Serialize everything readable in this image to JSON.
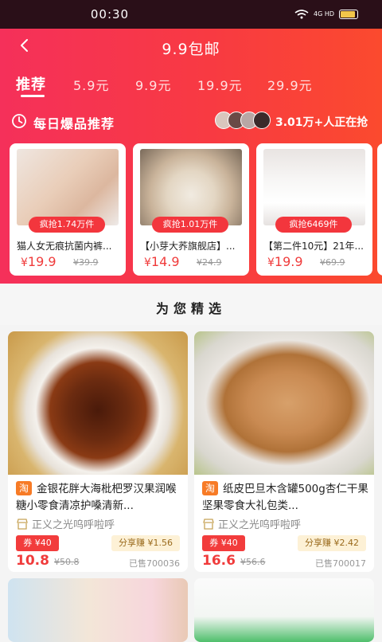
{
  "status": {
    "time": "00:30",
    "signal": "4G HD"
  },
  "nav": {
    "title": "9.9包邮"
  },
  "tabs": [
    "推荐",
    "5.9元",
    "9.9元",
    "19.9元",
    "29.9元"
  ],
  "daily": {
    "title": "每日爆品推荐",
    "grabbing": "3.01万+人正在抢"
  },
  "hot_items": [
    {
      "rush": "疯抢1.74万件",
      "name": "猫人女无痕抗菌内裤...",
      "price_symbol": "¥",
      "price": "19.9",
      "orig": "¥39.9"
    },
    {
      "rush": "疯抢1.01万件",
      "name": "【小芽大荞旗舰店】...",
      "price_symbol": "¥",
      "price": "14.9",
      "orig": "¥24.9"
    },
    {
      "rush": "疯抢6469件",
      "name": "【第二件10元】21年...",
      "price_symbol": "¥",
      "price": "19.9",
      "orig": "¥69.9"
    }
  ],
  "section": {
    "title": "为您精选"
  },
  "products": [
    {
      "badge": "淘",
      "title": "金银花胖大海枇杷罗汉果润喉糖小零食清凉护嗓清新...",
      "shop": "正义之光呜呼啦呼",
      "coupon": "券 ¥40",
      "share": "分享赚 ¥1.56",
      "price": "10.8",
      "orig": "¥50.8",
      "sold": "已售700036"
    },
    {
      "badge": "淘",
      "title": "纸皮巴旦木含罐500g杏仁干果坚果零食大礼包类...",
      "shop": "正义之光呜呼啦呼",
      "coupon": "券 ¥40",
      "share": "分享赚 ¥2.42",
      "price": "16.6",
      "orig": "¥56.6",
      "sold": "已售700017"
    }
  ],
  "colors": {
    "brand_red": "#f83a42",
    "price_red": "#f03b3b",
    "taobao_orange": "#f77b26"
  }
}
